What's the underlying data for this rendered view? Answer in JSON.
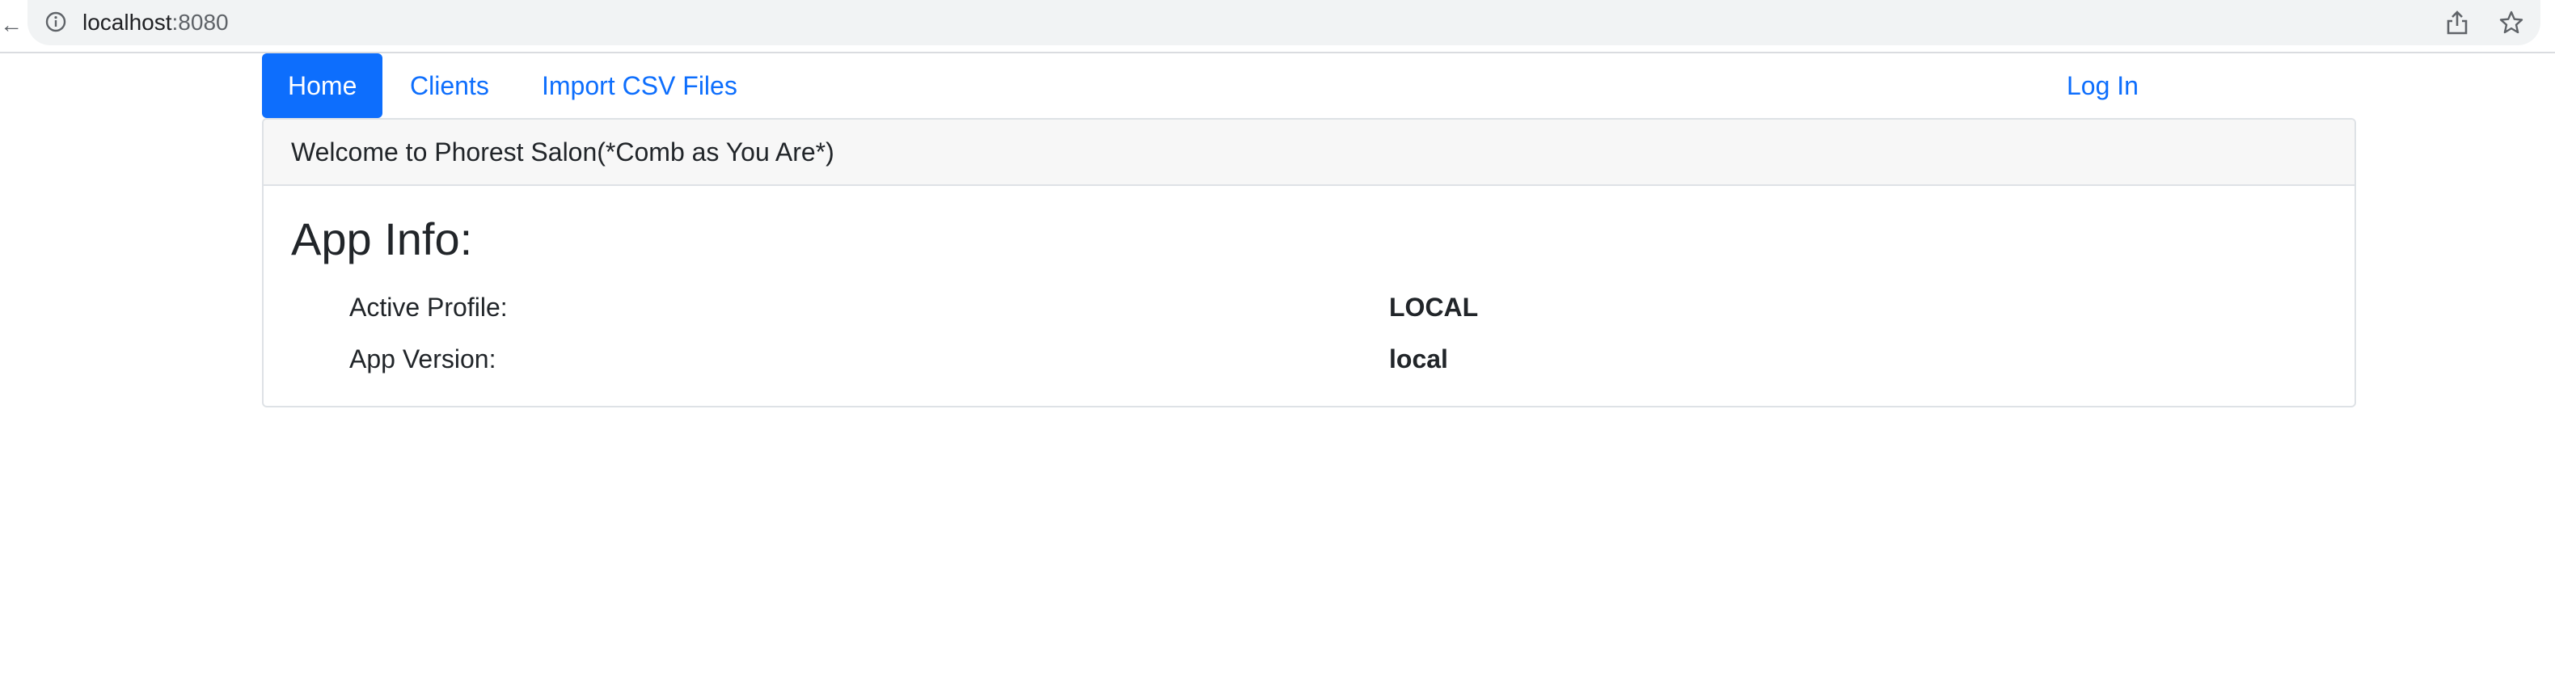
{
  "browser": {
    "url_host": "localhost",
    "url_port": ":8080",
    "icons": {
      "info": "info-circle-icon",
      "share": "share-icon",
      "bookmark": "star-icon"
    }
  },
  "nav": {
    "items": [
      {
        "label": "Home",
        "active": true
      },
      {
        "label": "Clients",
        "active": false
      },
      {
        "label": "Import CSV Files",
        "active": false
      }
    ],
    "login_label": "Log In"
  },
  "card": {
    "header": "Welcome to Phorest Salon(*Comb as You Are*)",
    "title": "App Info:",
    "rows": [
      {
        "label": "Active Profile:",
        "value": "LOCAL"
      },
      {
        "label": "App Version:",
        "value": "local"
      }
    ]
  },
  "colors": {
    "accent": "#0d6efd",
    "text": "#212529",
    "card_header_bg": "#f7f7f7",
    "border": "#dee2e6",
    "url_bar_bg": "#f1f3f4"
  }
}
